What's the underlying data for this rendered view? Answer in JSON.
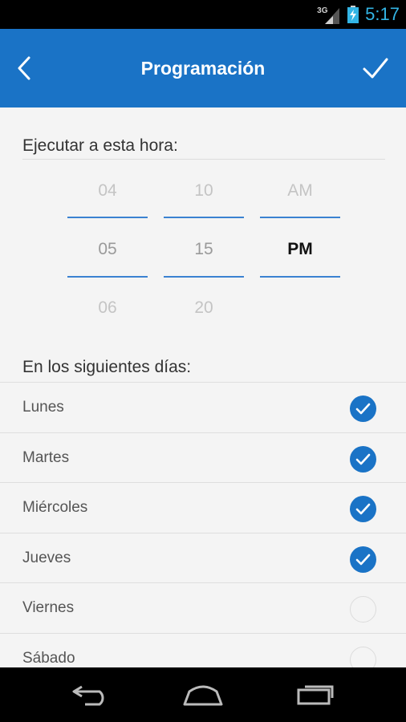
{
  "status_bar": {
    "network": "3G",
    "time": "5:17"
  },
  "app_bar": {
    "title": "Programación"
  },
  "schedule": {
    "time_label": "Ejecutar a esta hora:",
    "hour_column": [
      "04",
      "05",
      "06"
    ],
    "minute_column": [
      "10",
      "15",
      "20"
    ],
    "period_column": [
      "AM",
      "PM"
    ],
    "selected": {
      "hour": "05",
      "minute": "15",
      "period": "PM"
    }
  },
  "days": {
    "label": "En los siguientes días:",
    "items": [
      {
        "label": "Lunes",
        "checked": true
      },
      {
        "label": "Martes",
        "checked": true
      },
      {
        "label": "Miércoles",
        "checked": true
      },
      {
        "label": "Jueves",
        "checked": true
      },
      {
        "label": "Viernes",
        "checked": false
      },
      {
        "label": "Sábado",
        "checked": false
      }
    ]
  },
  "colors": {
    "accent": "#1a73c6",
    "status_time": "#33b5e5"
  }
}
